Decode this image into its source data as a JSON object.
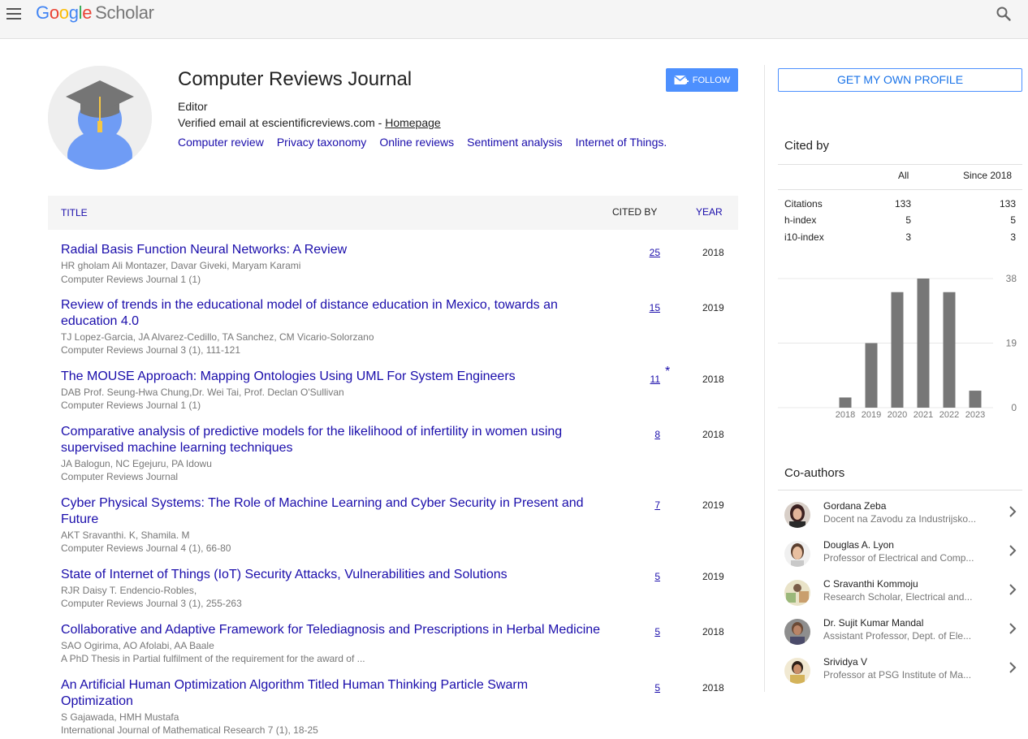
{
  "header": {
    "logo": {
      "google": [
        "G",
        "o",
        "o",
        "g",
        "l",
        "e"
      ],
      "scholar": "Scholar"
    }
  },
  "profile": {
    "name": "Computer Reviews Journal",
    "affiliation": "Editor",
    "email_prefix": "Verified email at escientificreviews.com - ",
    "homepage_label": "Homepage",
    "follow_label": "FOLLOW",
    "interests": [
      "Computer review",
      "Privacy taxonomy",
      "Online reviews",
      "Sentiment analysis",
      "Internet of Things."
    ]
  },
  "table": {
    "col_title": "TITLE",
    "col_cited": "CITED BY",
    "col_year": "YEAR",
    "articles": [
      {
        "title": "Radial Basis Function Neural Networks: A Review",
        "authors": "HR gholam Ali Montazer, Davar Giveki, Maryam Karami",
        "venue": "Computer Reviews Journal 1 (1)",
        "cited": "25",
        "star": "",
        "year": "2018"
      },
      {
        "title": "Review of trends in the educational model of distance education in Mexico, towards an education 4.0",
        "authors": "TJ Lopez-Garcia, JA Alvarez-Cedillo, TA Sanchez, CM Vicario-Solorzano",
        "venue": "Computer Reviews Journal 3 (1), 111-121",
        "cited": "15",
        "star": "",
        "year": "2019"
      },
      {
        "title": "The MOUSE Approach: Mapping Ontologies Using UML For System Engineers",
        "authors": "DAB Prof. Seung-Hwa Chung,Dr. Wei Tai, Prof. Declan O'Sullivan",
        "venue": "Computer Reviews Journal 1 (1)",
        "cited": "11",
        "star": "*",
        "year": "2018"
      },
      {
        "title": "Comparative analysis of predictive models for the likelihood of infertility in women using supervised machine learning techniques",
        "authors": "JA Balogun, NC Egejuru, PA Idowu",
        "venue": "Computer Reviews Journal",
        "cited": "8",
        "star": "",
        "year": "2018"
      },
      {
        "title": "Cyber Physical Systems: The Role of Machine Learning and Cyber Security in Present and Future",
        "authors": "AKT Sravanthi. K, Shamila. M",
        "venue": "Computer Reviews Journal 4 (1), 66-80",
        "cited": "7",
        "star": "",
        "year": "2019"
      },
      {
        "title": "State of Internet of Things (IoT) Security Attacks, Vulnerabilities and Solutions",
        "authors": "RJR Daisy T. Endencio-Robles,",
        "venue": "Computer Reviews Journal 3 (1), 255-263",
        "cited": "5",
        "star": "",
        "year": "2019"
      },
      {
        "title": "Collaborative and Adaptive Framework for Telediagnosis and Prescriptions in Herbal Medicine",
        "authors": "SAO Ogirima, AO Afolabi, AA Baale",
        "venue": "A PhD Thesis in Partial fulfilment of the requirement for the award of ...",
        "cited": "5",
        "star": "",
        "year": "2018"
      },
      {
        "title": "An Artificial Human Optimization Algorithm Titled Human Thinking Particle Swarm Optimization",
        "authors": "S Gajawada, HMH Mustafa",
        "venue": "International Journal of Mathematical Research 7 (1), 18-25",
        "cited": "5",
        "star": "",
        "year": "2018"
      }
    ]
  },
  "sidebar": {
    "own_profile_label": "GET MY OWN PROFILE",
    "cited_by_title": "Cited by",
    "col_all": "All",
    "col_since": "Since 2018",
    "metrics": [
      {
        "label": "Citations",
        "all": "133",
        "since": "133"
      },
      {
        "label": "h-index",
        "all": "5",
        "since": "5"
      },
      {
        "label": "i10-index",
        "all": "3",
        "since": "3"
      }
    ],
    "coauthors_title": "Co-authors",
    "coauthors": [
      {
        "name": "Gordana Zeba",
        "affiliation": "Docent na Zavodu za Industrijsko..."
      },
      {
        "name": "Douglas A. Lyon",
        "affiliation": "Professor of Electrical and Comp..."
      },
      {
        "name": "C Sravanthi Kommoju",
        "affiliation": "Research Scholar, Electrical and..."
      },
      {
        "name": "Dr. Sujit Kumar Mandal",
        "affiliation": "Assistant Professor, Dept. of Ele..."
      },
      {
        "name": "Srividya V",
        "affiliation": "Professor at PSG Institute of Ma..."
      }
    ]
  },
  "chart_data": {
    "type": "bar",
    "categories": [
      "2018",
      "2019",
      "2020",
      "2021",
      "2022",
      "2023"
    ],
    "values": [
      3,
      19,
      34,
      38,
      34,
      5
    ],
    "yticks": [
      "0",
      "19",
      "38"
    ],
    "ylim": [
      0,
      38
    ],
    "bar_color": "#777777"
  },
  "colors": {
    "link": "#1a0dab",
    "follow": "#4d90fe",
    "muted": "#777777"
  }
}
